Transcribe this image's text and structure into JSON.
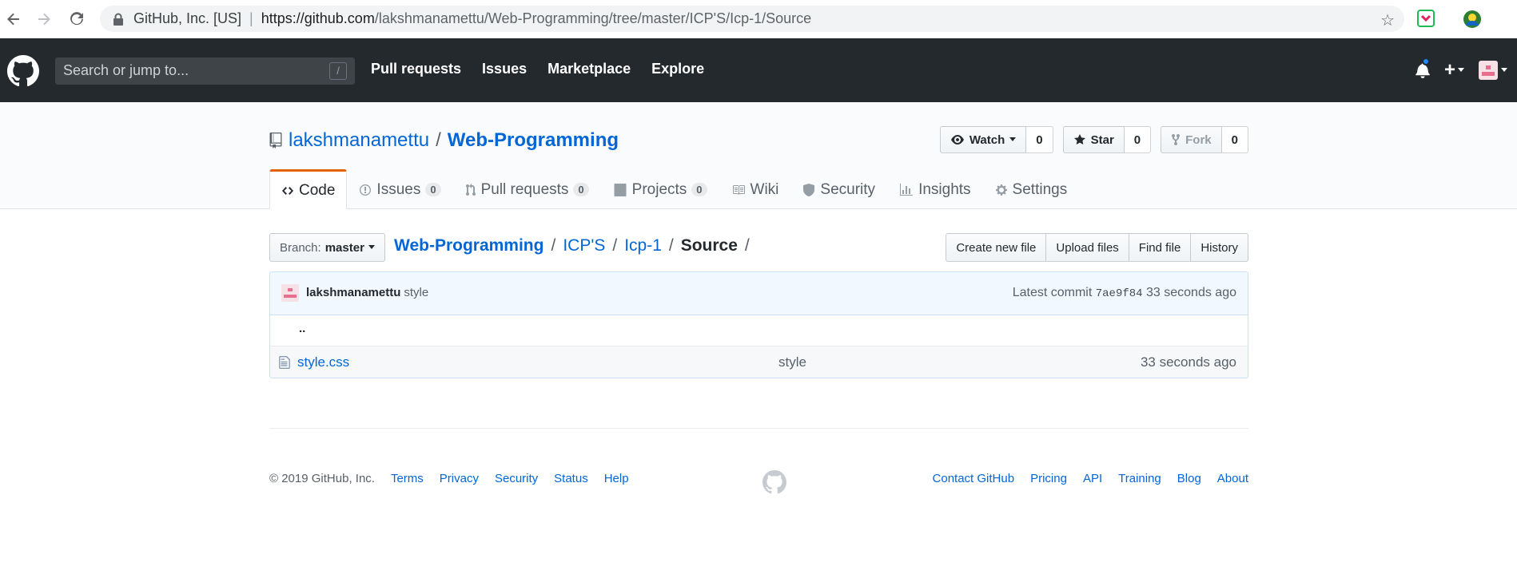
{
  "browser": {
    "site_label": "GitHub, Inc. [US]",
    "url_host": "https://github.com",
    "url_path": "/lakshmanamettu/Web-Programming/tree/master/ICP'S/Icp-1/Source"
  },
  "header": {
    "search_placeholder": "Search or jump to...",
    "search_shortcut": "/",
    "nav": [
      "Pull requests",
      "Issues",
      "Marketplace",
      "Explore"
    ]
  },
  "repo": {
    "owner": "lakshmanamettu",
    "name": "Web-Programming",
    "watch_label": "Watch",
    "watch_count": "0",
    "star_label": "Star",
    "star_count": "0",
    "fork_label": "Fork",
    "fork_count": "0"
  },
  "tabs": [
    {
      "label": "Code",
      "count": null
    },
    {
      "label": "Issues",
      "count": "0"
    },
    {
      "label": "Pull requests",
      "count": "0"
    },
    {
      "label": "Projects",
      "count": "0"
    },
    {
      "label": "Wiki",
      "count": null
    },
    {
      "label": "Security",
      "count": null
    },
    {
      "label": "Insights",
      "count": null
    },
    {
      "label": "Settings",
      "count": null
    }
  ],
  "file_nav": {
    "branch_label": "Branch:",
    "branch_value": "master",
    "breadcrumb": [
      "Web-Programming",
      "ICP'S",
      "Icp-1"
    ],
    "current": "Source",
    "actions": [
      "Create new file",
      "Upload files",
      "Find file",
      "History"
    ]
  },
  "commit": {
    "author": "lakshmanamettu",
    "message": "style",
    "latest_label": "Latest commit",
    "sha": "7ae9f84",
    "age": "33 seconds ago"
  },
  "up_tree": "..",
  "files": [
    {
      "name": "style.css",
      "message": "style",
      "age": "33 seconds ago"
    }
  ],
  "footer": {
    "copyright": "© 2019 GitHub, Inc.",
    "left_links": [
      "Terms",
      "Privacy",
      "Security",
      "Status",
      "Help"
    ],
    "right_links": [
      "Contact GitHub",
      "Pricing",
      "API",
      "Training",
      "Blog",
      "About"
    ]
  },
  "colors": {
    "header_bg": "#24292e",
    "link": "#0366d6",
    "tab_accent": "#e36209"
  }
}
